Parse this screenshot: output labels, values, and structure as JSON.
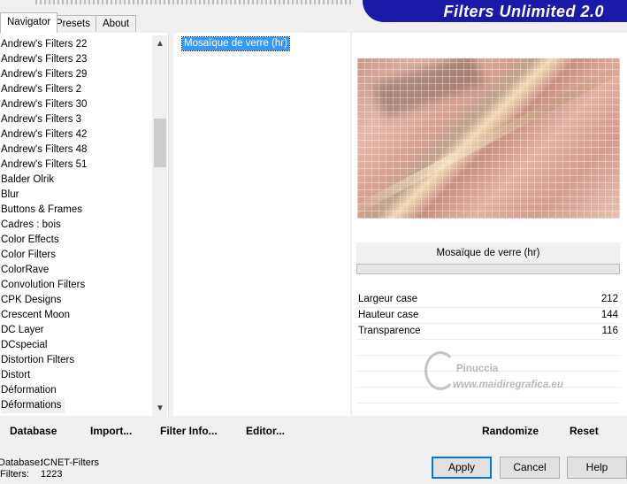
{
  "app": {
    "title": "Filters Unlimited 2.0"
  },
  "tabs": [
    {
      "label": "Navigator",
      "active": true
    },
    {
      "label": "Presets",
      "active": false
    },
    {
      "label": "About",
      "active": false
    }
  ],
  "categories": [
    "Andrew's Filters 22",
    "Andrew's Filters 23",
    "Andrew's Filters 29",
    "Andrew's Filters 2",
    "Andrew's Filters 30",
    "Andrew's Filters 3",
    "Andrew's Filters 42",
    "Andrew's Filters 48",
    "Andrew's Filters 51",
    "Balder Olrik",
    "Blur",
    "Buttons & Frames",
    "Cadres : bois",
    "Color Effects",
    "Color Filters",
    "ColorRave",
    "Convolution Filters",
    "CPK Designs",
    "Crescent Moon",
    "DC Layer",
    "DCspecial",
    "Distortion Filters",
    "Distort",
    "Déformation",
    "Déformations"
  ],
  "selected_category": "Déformations",
  "filters": [
    "Mosaïque de verre (hr)"
  ],
  "selected_filter": "Mosaïque de verre (hr)",
  "preview": {
    "filter_name": "Mosaïque de verre (hr)"
  },
  "params": [
    {
      "label": "Largeur case",
      "value": "212"
    },
    {
      "label": "Hauteur case",
      "value": "144"
    },
    {
      "label": "Transparence",
      "value": "116"
    }
  ],
  "toolbar": {
    "database": "Database",
    "import": "Import...",
    "filter_info": "Filter Info...",
    "editor": "Editor...",
    "randomize": "Randomize",
    "reset": "Reset"
  },
  "status": {
    "database_label": "Database:",
    "database_value": "ICNET-Filters",
    "filters_label": "Filters:",
    "filters_value": "1223"
  },
  "dialog": {
    "apply": "Apply",
    "cancel": "Cancel",
    "help": "Help"
  },
  "watermark": {
    "author": "Pinuccia",
    "site": "www.maidiregrafica.eu"
  },
  "colors": {
    "banner": "#1a1aa8",
    "selection": "#3399ff",
    "default_button_border": "#0078d7"
  }
}
